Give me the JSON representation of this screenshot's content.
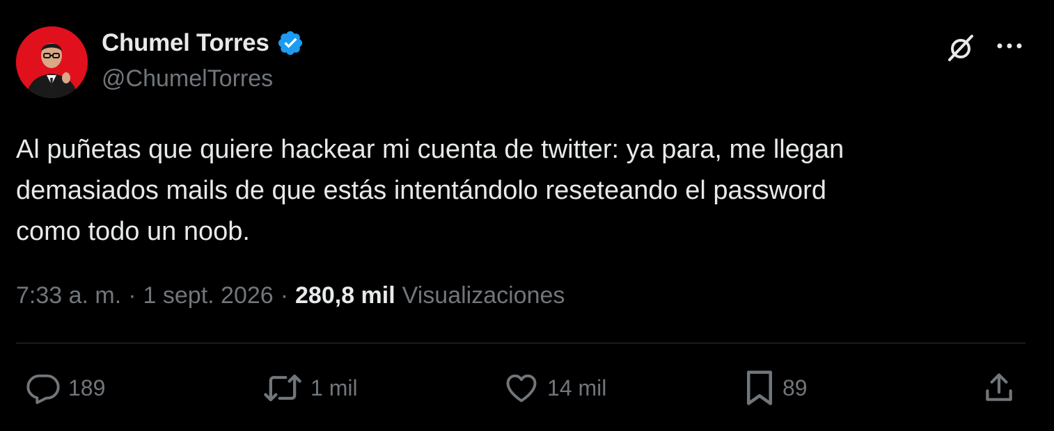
{
  "author": {
    "display_name": "Chumel Torres",
    "handle": "@ChumelTorres",
    "verified": true,
    "avatar_color": "#e0101c"
  },
  "tweet": {
    "text": "Al puñetas que quiere hackear mi cuenta de twitter: ya para, me llegan\ndemasiados mails de que estás intentándolo reseteando el password\ncomo todo un noob."
  },
  "meta": {
    "time": "7:33 a. m.",
    "separator": "·",
    "date": "1 sept. 2026",
    "views_count": "280,8 mil",
    "views_label": "Visualizaciones"
  },
  "actions": {
    "replies": "189",
    "reposts": "1 mil",
    "likes": "14 mil",
    "bookmarks": "89"
  },
  "icons": {
    "verified": "verified-badge-icon",
    "grok": "grok-icon",
    "more": "more-icon",
    "reply": "reply-icon",
    "repost": "repost-icon",
    "like": "heart-icon",
    "bookmark": "bookmark-icon",
    "share": "share-icon"
  },
  "colors": {
    "background": "#000000",
    "text": "#e7e9ea",
    "muted": "#71767b",
    "verified": "#1d9bf0",
    "divider": "#2f3336"
  }
}
